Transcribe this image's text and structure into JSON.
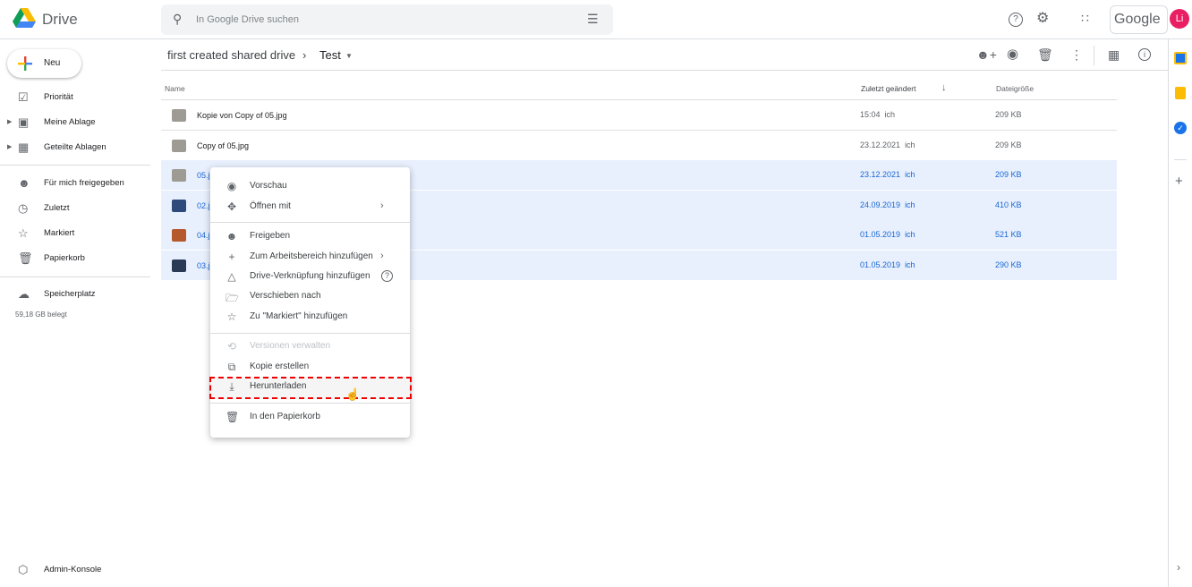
{
  "app": {
    "title": "Drive",
    "account_brand": "Google",
    "avatar_initials": "Li"
  },
  "search": {
    "placeholder": "In Google Drive suchen"
  },
  "sidebar": {
    "new_label": "Neu",
    "items": [
      {
        "label": "Priorität",
        "icon": "priority-icon"
      },
      {
        "label": "Meine Ablage",
        "icon": "my-drive-icon"
      },
      {
        "label": "Geteilte Ablagen",
        "icon": "shared-drives-icon"
      },
      {
        "label": "Für mich freigegeben",
        "icon": "shared-icon"
      },
      {
        "label": "Zuletzt",
        "icon": "clock-icon"
      },
      {
        "label": "Markiert",
        "icon": "star-icon"
      },
      {
        "label": "Papierkorb",
        "icon": "trash-icon"
      },
      {
        "label": "Speicherplatz",
        "icon": "cloud-icon"
      }
    ],
    "storage_used": "59,18 GB belegt",
    "admin": "Admin-Konsole"
  },
  "breadcrumb": {
    "parent": "first created shared drive",
    "current": "Test"
  },
  "table": {
    "headers": {
      "name": "Name",
      "modified": "Zuletzt geändert",
      "size": "Dateigröße"
    },
    "rows": [
      {
        "name": "Kopie von Copy of 05.jpg",
        "date": "15:04",
        "owner": "ich",
        "size": "209 KB",
        "selected": false,
        "thumb": "#9e9a94"
      },
      {
        "name": "Copy of 05.jpg",
        "date": "23.12.2021",
        "owner": "ich",
        "size": "209 KB",
        "selected": false,
        "thumb": "#9e9a94"
      },
      {
        "name": "05.jpg",
        "date": "23.12.2021",
        "owner": "ich",
        "size": "209 KB",
        "selected": true,
        "thumb": "#9e9a94"
      },
      {
        "name": "02.jpg",
        "date": "24.09.2019",
        "owner": "ich",
        "size": "410 KB",
        "selected": true,
        "thumb": "#2d4a7a"
      },
      {
        "name": "04.jpg",
        "date": "01.05.2019",
        "owner": "ich",
        "size": "521 KB",
        "selected": true,
        "thumb": "#b5582c"
      },
      {
        "name": "03.jpg",
        "date": "01.05.2019",
        "owner": "ich",
        "size": "290 KB",
        "selected": true,
        "thumb": "#2a3a55"
      }
    ]
  },
  "context_menu": {
    "items": [
      {
        "label": "Vorschau",
        "icon": "eye-icon"
      },
      {
        "label": "Öffnen mit",
        "icon": "open-with-icon",
        "submenu": true
      },
      {
        "label": "Freigeben",
        "icon": "share-icon"
      },
      {
        "label": "Zum Arbeitsbereich hinzufügen",
        "icon": "plus-icon",
        "submenu": true
      },
      {
        "label": "Drive-Verknüpfung hinzufügen",
        "icon": "shortcut-icon",
        "help": true
      },
      {
        "label": "Verschieben nach",
        "icon": "move-icon"
      },
      {
        "label": "Zu \"Markiert\" hinzufügen",
        "icon": "star-icon"
      },
      {
        "label": "Versionen verwalten",
        "icon": "history-icon",
        "disabled": true
      },
      {
        "label": "Kopie erstellen",
        "icon": "copy-icon"
      },
      {
        "label": "Herunterladen",
        "icon": "download-icon",
        "highlighted": true
      },
      {
        "label": "In den Papierkorb",
        "icon": "trash-icon"
      }
    ]
  }
}
